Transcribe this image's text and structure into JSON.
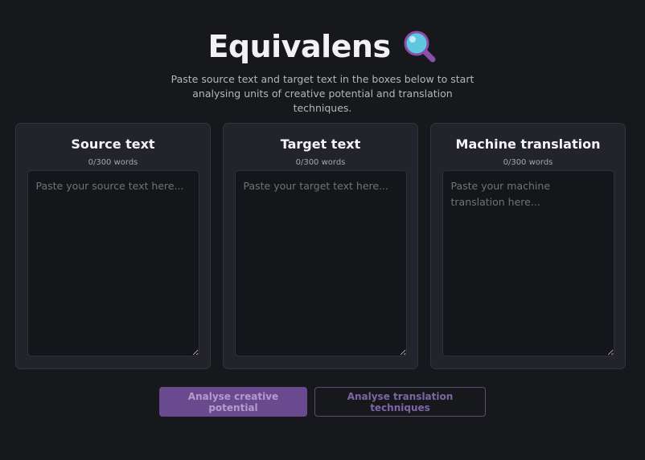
{
  "header": {
    "title": "Equivalens",
    "title_icon": "magnifying-glass-icon",
    "subtitle": "Paste source text and target text in the boxes below to start analysing units of creative potential and translation techniques."
  },
  "panels": [
    {
      "title": "Source text",
      "word_count": "0/300 words",
      "value": "",
      "placeholder": "Paste your source text here..."
    },
    {
      "title": "Target text",
      "word_count": "0/300 words",
      "value": "",
      "placeholder": "Paste your target text here..."
    },
    {
      "title": "Machine translation",
      "word_count": "0/300 words",
      "value": "",
      "placeholder": "Paste your machine translation here..."
    }
  ],
  "actions": {
    "creative_label": "Analyse creative potential",
    "techniques_label": "Analyse translation techniques"
  },
  "colors": {
    "background": "#17181c",
    "panel": "#23242b",
    "accent": "#6a4a8f"
  }
}
